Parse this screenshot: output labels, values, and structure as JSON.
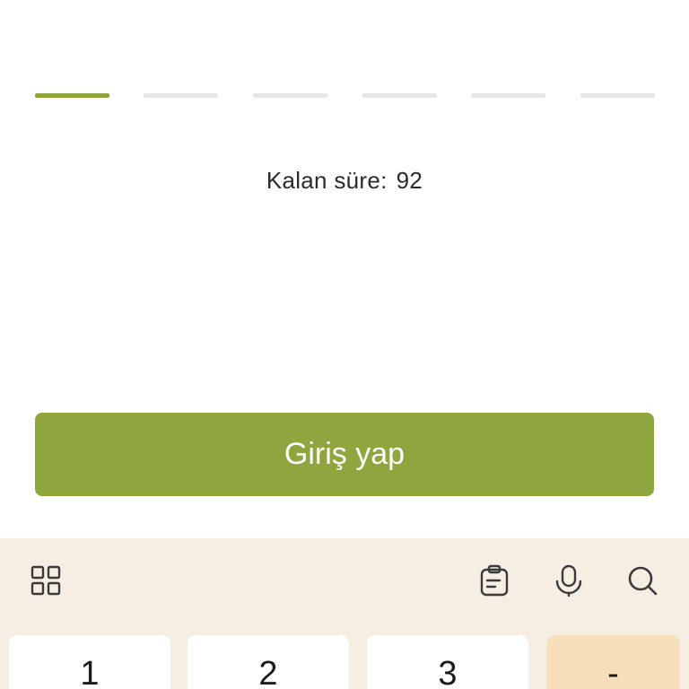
{
  "otp": {
    "segment_count": 6,
    "active_index": 0,
    "active_color": "#8fa63f",
    "inactive_color": "#e6e6e6"
  },
  "timer": {
    "label": "Kalan süre:",
    "value": "92"
  },
  "login_button": {
    "label": "Giriş yap",
    "color": "#8fa63f"
  },
  "keyboard": {
    "background": "#f7eee3",
    "toolbar": {
      "left_icon": "apps-grid-icon",
      "right_icons": [
        "clipboard-icon",
        "microphone-icon",
        "search-icon"
      ]
    },
    "keys": [
      "1",
      "2",
      "3",
      "-"
    ]
  }
}
